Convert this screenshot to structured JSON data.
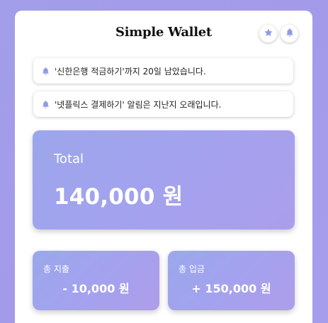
{
  "app": {
    "title": "Simple Wallet"
  },
  "header": {
    "icons": [
      "star-icon",
      "bell-icon"
    ]
  },
  "notices": [
    {
      "icon": "bell-icon",
      "text": "'신한은행 적금하기'까지 20일 남았습니다."
    },
    {
      "icon": "bell-icon",
      "text": "'넷플릭스 결제하기' 알림은 지난지 오래입니다."
    }
  ],
  "total": {
    "label": "Total",
    "value": "140,000 원"
  },
  "summary": {
    "spend": {
      "label": "총 지출",
      "value": "- 10,000 원"
    },
    "income": {
      "label": "총 입금",
      "value": "+ 150,000 원"
    }
  },
  "colors": {
    "accent": "#a29ee9",
    "icon": "#8f9be6"
  }
}
